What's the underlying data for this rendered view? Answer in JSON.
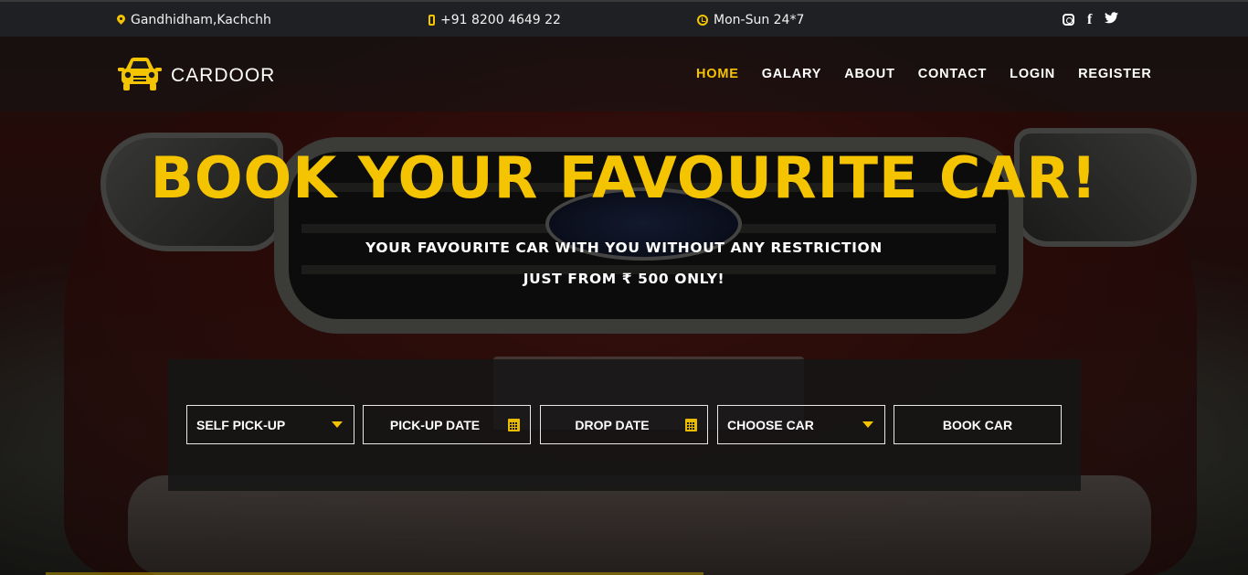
{
  "topbar": {
    "location": "Gandhidham,Kachchh",
    "phone": "+91 8200 4649 22",
    "hours": "Mon-Sun 24*7",
    "social": [
      "instagram-icon",
      "facebook-icon",
      "twitter-icon"
    ]
  },
  "brand": {
    "name": "CARDOOR"
  },
  "nav": {
    "items": [
      "HOME",
      "GALARY",
      "ABOUT",
      "CONTACT",
      "LOGIN",
      "REGISTER"
    ],
    "active": "HOME"
  },
  "hero": {
    "title": "BOOK YOUR FAVOURITE CAR!",
    "subtitle_1": "YOUR FAVOURITE CAR WITH YOU WITHOUT ANY RESTRICTION",
    "subtitle_2": "JUST FROM ₹ 500 ONLY!"
  },
  "booking": {
    "pickup_type": "SELF PICK-UP",
    "pickup_date": "PICK-UP DATE",
    "drop_date": "DROP DATE",
    "car": "CHOOSE CAR",
    "submit": "BOOK CAR"
  },
  "colors": {
    "accent": "#f5c400",
    "topbar_bg": "#1f2023"
  }
}
